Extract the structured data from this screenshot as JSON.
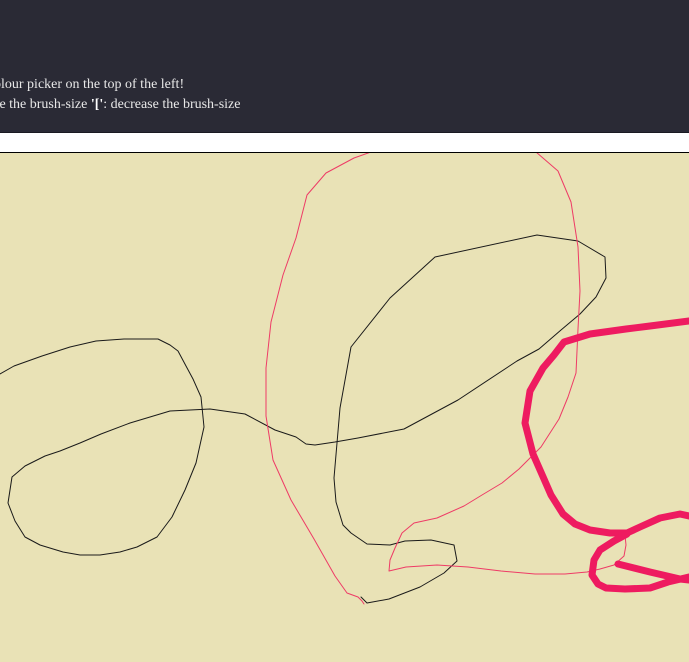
{
  "instructions": {
    "line1": "olour picker on the top of the left!",
    "line2_prefix": "se the brush-size ",
    "line2_key": "'['",
    "line2_suffix": ": decrease the brush-size"
  },
  "canvas": {
    "background": "#e9e2b6",
    "strokes": [
      {
        "name": "black-stroke-1",
        "color": "#1a1a1a",
        "brush_size": 1
      },
      {
        "name": "black-stroke-2",
        "color": "#1a1a1a",
        "brush_size": 1
      },
      {
        "name": "pink-stroke-thin",
        "color": "#ee3b66",
        "brush_size": 1
      },
      {
        "name": "pink-stroke-thick",
        "color": "#ee1b60",
        "brush_size": 7
      }
    ]
  }
}
